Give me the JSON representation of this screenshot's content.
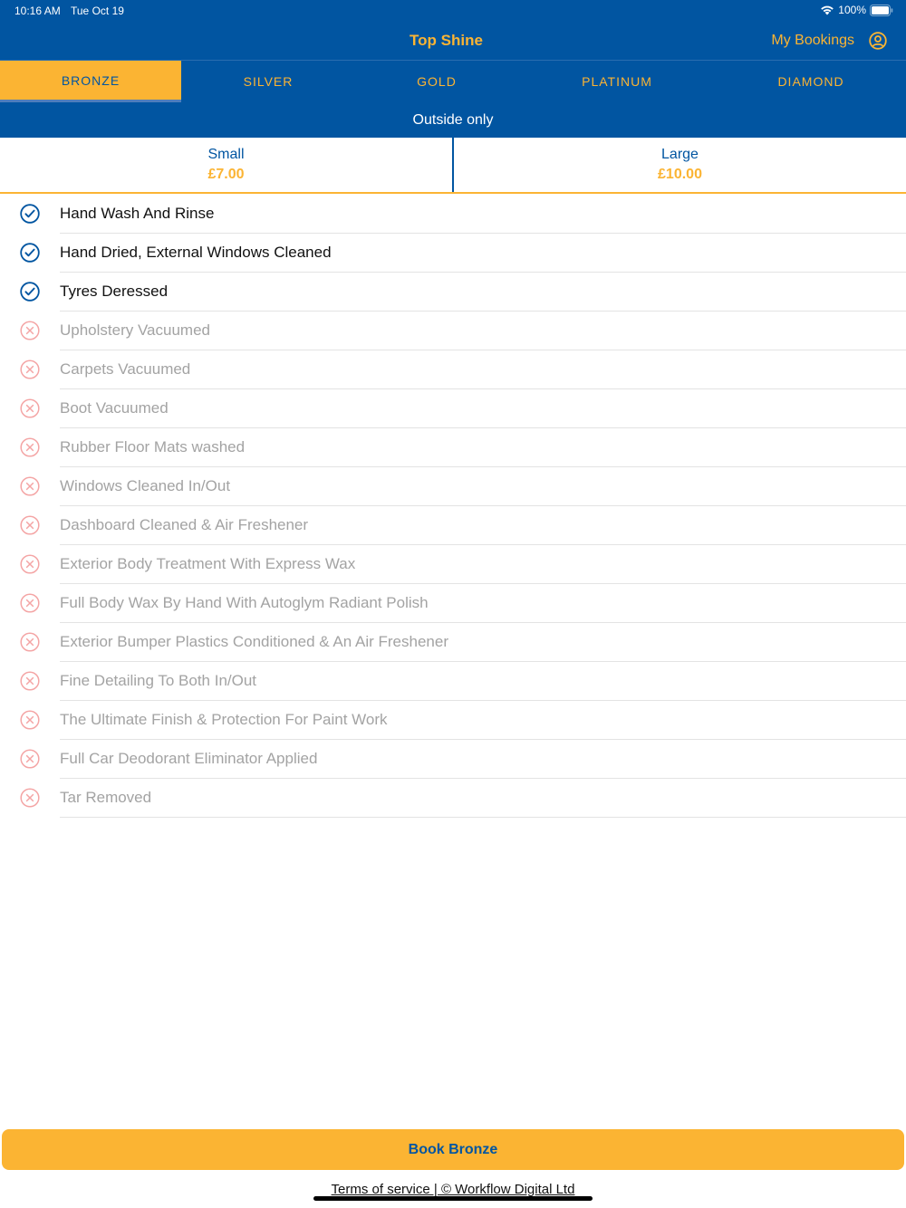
{
  "status_bar": {
    "time": "10:16 AM",
    "date": "Tue Oct 19",
    "battery": "100%",
    "icons": [
      "wifi-icon",
      "battery-icon"
    ]
  },
  "nav": {
    "title": "Top Shine",
    "my_bookings": "My Bookings",
    "account_icon": "account-circle-icon"
  },
  "tabs": [
    {
      "label": "BRONZE",
      "active": true
    },
    {
      "label": "SILVER",
      "active": false
    },
    {
      "label": "GOLD",
      "active": false
    },
    {
      "label": "PLATINUM",
      "active": false
    },
    {
      "label": "DIAMOND",
      "active": false
    }
  ],
  "tier_subtitle": "Outside only",
  "sizes": [
    {
      "name": "Small",
      "price": "£7.00"
    },
    {
      "name": "Large",
      "price": "£10.00"
    }
  ],
  "features": [
    {
      "label": "Hand Wash And Rinse",
      "included": true
    },
    {
      "label": "Hand Dried, External Windows Cleaned",
      "included": true
    },
    {
      "label": "Tyres Deressed",
      "included": true
    },
    {
      "label": "Upholstery Vacuumed",
      "included": false
    },
    {
      "label": "Carpets Vacuumed",
      "included": false
    },
    {
      "label": "Boot Vacuumed",
      "included": false
    },
    {
      "label": "Rubber Floor Mats washed",
      "included": false
    },
    {
      "label": "Windows Cleaned In/Out",
      "included": false
    },
    {
      "label": "Dashboard Cleaned & Air Freshener",
      "included": false
    },
    {
      "label": "Exterior Body Treatment With Express Wax",
      "included": false
    },
    {
      "label": "Full Body Wax By Hand With Autoglym Radiant Polish",
      "included": false
    },
    {
      "label": "Exterior Bumper Plastics Conditioned & An Air Freshener",
      "included": false
    },
    {
      "label": "Fine Detailing To Both In/Out",
      "included": false
    },
    {
      "label": "The Ultimate Finish & Protection For Paint Work",
      "included": false
    },
    {
      "label": "Full Car Deodorant Eliminator Applied",
      "included": false
    },
    {
      "label": "Tar Removed",
      "included": false
    }
  ],
  "book_button": "Book Bronze",
  "footer": "Terms of service | © Workflow Digital Ltd",
  "colors": {
    "primary_blue": "#0155a1",
    "accent_gold": "#fbb433",
    "excluded_red": "#f4a5a5",
    "excluded_text": "#a3a3a3"
  }
}
